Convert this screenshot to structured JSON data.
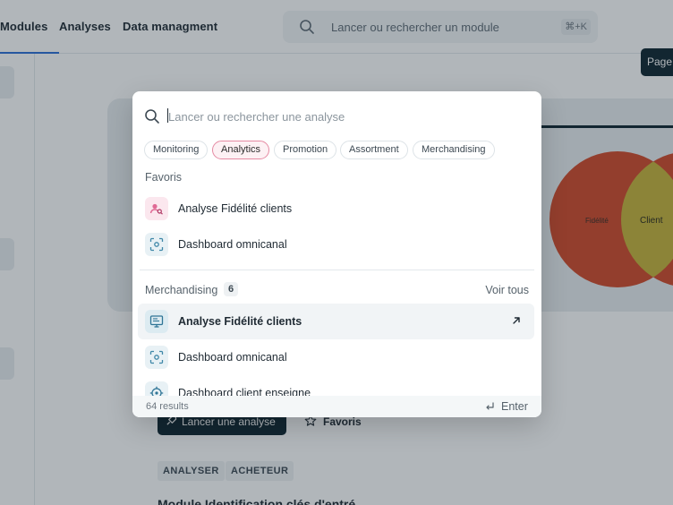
{
  "nav": {
    "items": [
      "Modules",
      "Analyses",
      "Data managment"
    ]
  },
  "global_search": {
    "placeholder": "Lancer ou rechercher un module",
    "shortcut": "⌘+K"
  },
  "page_chip": "Page",
  "hero": {
    "venn_left": "Fidélité",
    "venn_right": "Client"
  },
  "actions": {
    "launch_label": "Lancer une analyse",
    "favorites_label": "Favoris"
  },
  "tags": [
    "ANALYSER",
    "ACHETEUR"
  ],
  "module_title": "Module Identification clés d'entré",
  "modal": {
    "search_placeholder": "Lancer ou rechercher une analyse",
    "filters": [
      {
        "label": "Monitoring",
        "active": false
      },
      {
        "label": "Analytics",
        "active": true
      },
      {
        "label": "Promotion",
        "active": false
      },
      {
        "label": "Assortment",
        "active": false
      },
      {
        "label": "Merchandising",
        "active": false
      }
    ],
    "favorites": {
      "title": "Favoris",
      "items": [
        {
          "label": "Analyse Fidélité clients",
          "icon": "user-search-icon"
        },
        {
          "label": "Dashboard omnicanal",
          "icon": "scan-icon"
        }
      ]
    },
    "merchandising": {
      "title": "Merchandising",
      "count": "6",
      "see_all": "Voir tous",
      "items": [
        {
          "label": "Analyse Fidélité clients",
          "icon": "monitor-icon",
          "highlighted": true
        },
        {
          "label": "Dashboard omnicanal",
          "icon": "scan-icon",
          "highlighted": false
        },
        {
          "label": "Dashboard client enseigne",
          "icon": "target-icon",
          "highlighted": false
        }
      ]
    },
    "footer": {
      "results": "64 results",
      "enter_label": "Enter"
    }
  },
  "colors": {
    "brand_dark": "#0f2530",
    "active_chip_border": "#e58aa3",
    "venn_red": "#d24a2a",
    "venn_yellow": "#c7b43a"
  }
}
